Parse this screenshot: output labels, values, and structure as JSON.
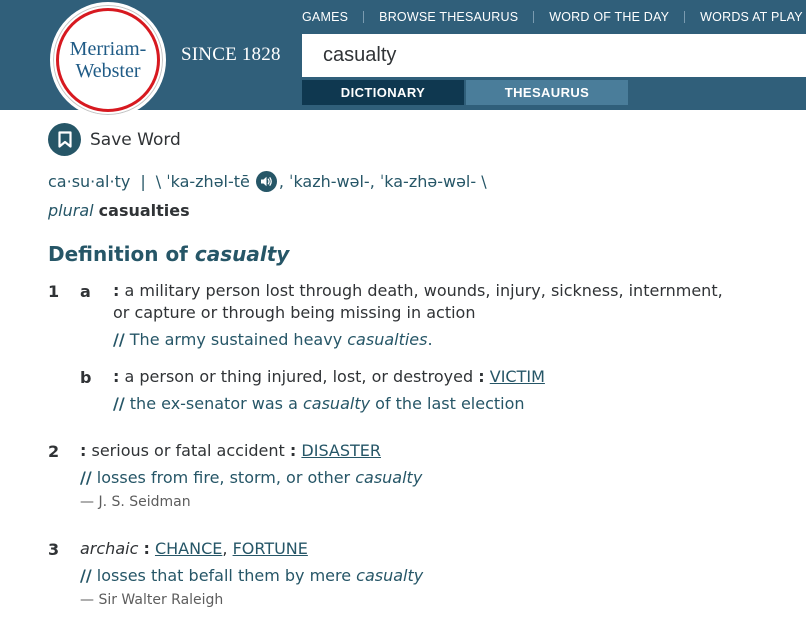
{
  "header": {
    "logo_line1": "Merriam-",
    "logo_line2": "Webster",
    "since": "SINCE 1828",
    "nav": [
      "GAMES",
      "BROWSE THESAURUS",
      "WORD OF THE DAY",
      "WORDS AT PLAY"
    ],
    "search_value": "casualty",
    "tabs": {
      "dictionary": "DICTIONARY",
      "thesaurus": "THESAURUS"
    }
  },
  "entry": {
    "save_label": "Save Word",
    "syllables": "ca·su·al·ty",
    "separator": "|",
    "pron_open": "\\ ˈka-zhəl-tē",
    "pron_rest": ", ˈkazh-wəl-, ˈka-zhə-wəl- \\",
    "plural_label": "plural",
    "plural_form": "casualties",
    "definition_heading": "Definition of",
    "headword": "casualty"
  },
  "senses": {
    "s1": {
      "num": "1",
      "a": {
        "letter": "a",
        "text_line1": "a military person lost through death, wounds, injury, sickness, internment,",
        "text_line2": "or capture or through being missing in action",
        "example_pre": "The army sustained heavy ",
        "example_em": "casualties",
        "example_post": "."
      },
      "b": {
        "letter": "b",
        "text": "a person or thing injured, lost, or destroyed",
        "xref": "VICTIM",
        "example_pre": "the ex-senator was a ",
        "example_em": "casualty",
        "example_post": " of the last election"
      }
    },
    "s2": {
      "num": "2",
      "text": "serious or fatal accident",
      "xref": "DISASTER",
      "example_pre": "losses from fire, storm, or other ",
      "example_em": "casualty",
      "attribution": "— J. S. Seidman"
    },
    "s3": {
      "num": "3",
      "label": "archaic",
      "xref1": "CHANCE",
      "xref2": "FORTUNE",
      "example_pre": "losses that befall them by mere ",
      "example_em": "casualty",
      "attribution": "— Sir Walter Raleigh"
    }
  },
  "colors": {
    "header_bg": "#305f7a",
    "accent": "#265667",
    "logo_red": "#d71920",
    "tab_active": "#0f3850",
    "tab_inactive": "#4a7d9a"
  },
  "icons": {
    "save": "bookmark-icon",
    "audio": "speaker-icon"
  }
}
